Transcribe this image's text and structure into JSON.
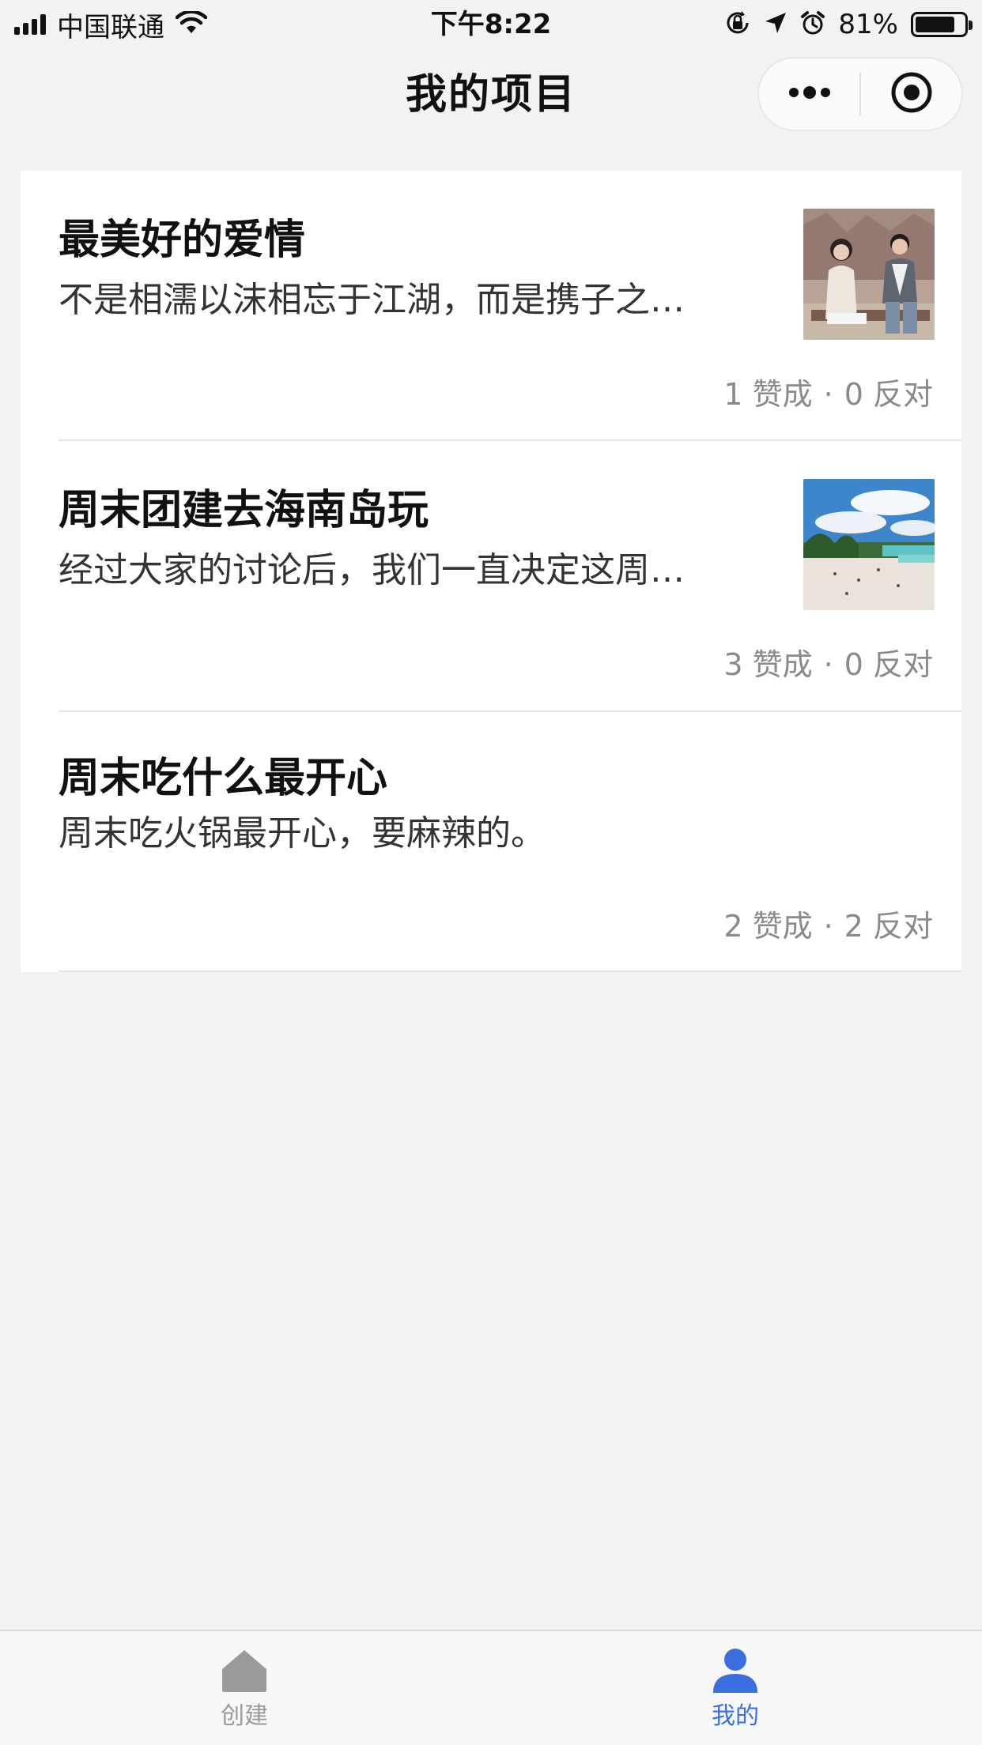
{
  "status_bar": {
    "carrier": "中国联通",
    "time": "下午8:22",
    "battery_pct": "81%",
    "battery_level": 0.81
  },
  "nav": {
    "title": "我的项目",
    "more_icon": "more-dots-icon",
    "close_icon": "record-circle-icon"
  },
  "items": [
    {
      "title": "最美好的爱情",
      "desc": "不是相濡以沫相忘于江湖，而是携子之…",
      "votes_for": "1 赞成",
      "separator": "·",
      "votes_against": "0 反对",
      "thumb": "couple-photo"
    },
    {
      "title": "周末团建去海南岛玩",
      "desc": "经过大家的讨论后，我们一直决定这周…",
      "votes_for": "3 赞成",
      "separator": "·",
      "votes_against": "0 反对",
      "thumb": "beach-photo"
    },
    {
      "title": "周末吃什么最开心",
      "desc": "周末吃火锅最开心，要麻辣的。",
      "votes_for": "2 赞成",
      "separator": "·",
      "votes_against": "2 反对"
    }
  ],
  "tabs": [
    {
      "label": "创建",
      "icon": "home-icon",
      "active": false
    },
    {
      "label": "我的",
      "icon": "user-icon",
      "active": true
    }
  ],
  "colors": {
    "active_tab": "#3b6fe0",
    "inactive_tab": "#9a9a9a",
    "background": "#f2f2f2"
  }
}
